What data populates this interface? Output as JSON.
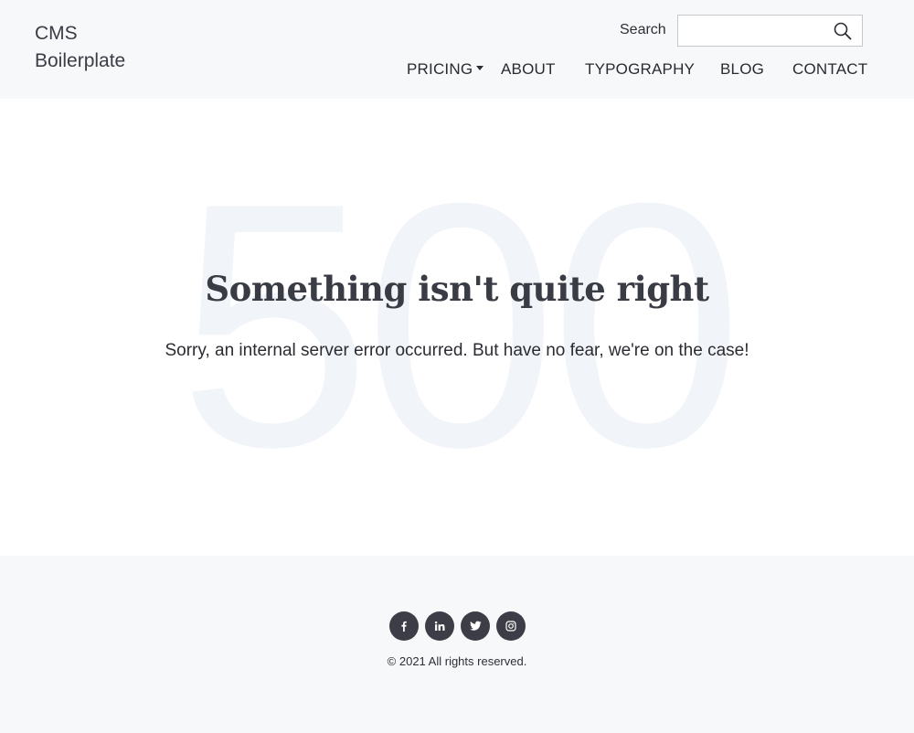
{
  "header": {
    "logo": "CMS Boilerplate",
    "search_label": "Search",
    "search_value": "",
    "search_icon": "magnifier-icon"
  },
  "nav": {
    "items": [
      {
        "label": "PRICING",
        "has_dropdown": true
      },
      {
        "label": "ABOUT"
      },
      {
        "label": "TYPOGRAPHY"
      },
      {
        "label": "BLOG"
      },
      {
        "label": "CONTACT"
      }
    ]
  },
  "error": {
    "code": "500",
    "headline": "Something isn't quite right",
    "message": "Sorry, an internal server error occurred. But have no fear, we're on the case!"
  },
  "footer": {
    "socials": [
      "facebook-icon",
      "linkedin-icon",
      "twitter-icon",
      "instagram-icon"
    ],
    "copyright": "© 2021 All rights reserved."
  },
  "colors": {
    "header_bg": "#f7f8fa",
    "footer_bg": "#f7f8fa",
    "social_bg": "#3c3d46",
    "watermark": "#f1f4f8",
    "text": "#33333d"
  }
}
